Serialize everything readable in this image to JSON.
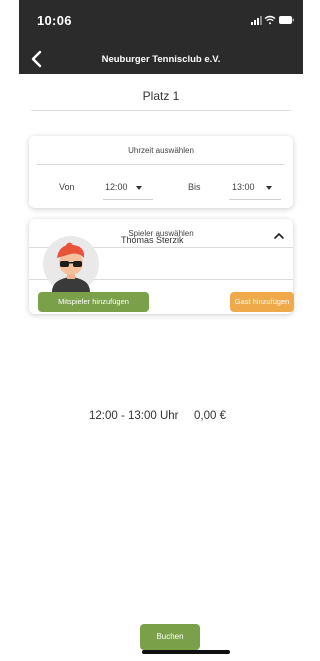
{
  "status_bar": {
    "time": "10:06"
  },
  "nav": {
    "title": "Neuburger Tennisclub e.V."
  },
  "court": {
    "name": "Platz 1"
  },
  "time_card": {
    "title": "Uhrzeit auswählen",
    "from_label": "Von",
    "from_value": "12:00",
    "to_label": "Bis",
    "to_value": "13:00"
  },
  "players_card": {
    "title": "Spieler auswählen",
    "expanded": true,
    "players": [
      {
        "name": "Thomas Sterzik"
      }
    ],
    "add_teammate_label": "Mitspieler hinzufügen",
    "add_guest_label": "Gast hinzufügen"
  },
  "summary": {
    "time_range": "12:00 - 13:00 Uhr",
    "price": "0,00 €"
  },
  "actions": {
    "book_label": "Buchen"
  },
  "colors": {
    "header": "#2b2b2b",
    "green": "#7ba04a",
    "orange": "#f0a94a",
    "avatar_bg": "#e9e9e9",
    "hair": "#e8533a"
  }
}
